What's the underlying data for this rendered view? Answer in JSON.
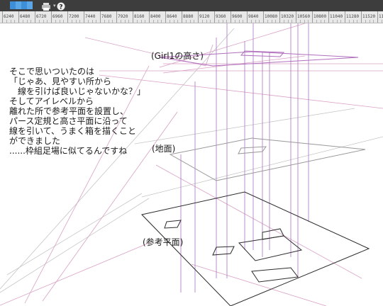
{
  "toolbar": {
    "tools": [
      "brush-tool",
      "pen-tool",
      "pencil-tool",
      "marker-tool",
      "eraser-tool"
    ],
    "colors": {
      "background": "#3d3d3d",
      "tool_blue": "#3d8fd8",
      "help_bg": "#eeeeee"
    }
  },
  "ruler": {
    "ticks": [
      "6240",
      "6480",
      "6720",
      "6960",
      "7200",
      "7440",
      "7680",
      "7920",
      "8160",
      "8400",
      "8640",
      "8880",
      "9120",
      "9360",
      "9600",
      "9840",
      "10080",
      "10320",
      "10560",
      "10800",
      "11040",
      "11280",
      "11520",
      "11760"
    ]
  },
  "canvas": {
    "note_lines": [
      "そこで思いついたのは",
      "「じゃあ、見やすい所から",
      "　線を引けば良いじゃないかな？」",
      "そしてアイレベルから",
      "離れた所で参考平面を設置し、",
      "パース定規と高さ平面に沿って",
      "線を引いて、うまく箱を描くこと",
      "ができました",
      "......枠組足場に似てるんですね"
    ],
    "label_girl_height": "(Girl1の高さ)",
    "label_ground": "(地面)",
    "label_reference_plane": "(参考平面)",
    "colors": {
      "dark_line": "#2b2b2b",
      "purple_line": "#a875c0",
      "pink_line": "#d9a0c4",
      "gray_line": "#c6c6c6"
    }
  }
}
